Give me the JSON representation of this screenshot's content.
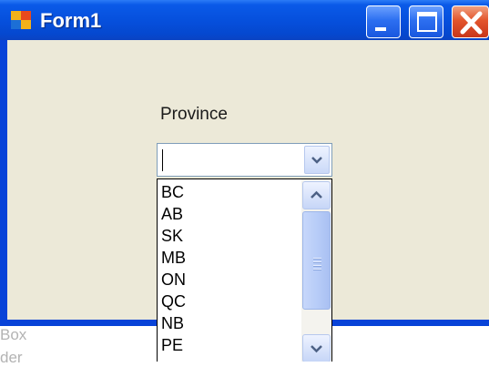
{
  "window": {
    "title": "Form1",
    "controls": {
      "minimize": "minimize",
      "maximize": "maximize",
      "close": "close"
    }
  },
  "form": {
    "province_label": "Province",
    "combo": {
      "value": "",
      "placeholder": ""
    },
    "dropdown_items": [
      "BC",
      "AB",
      "SK",
      "MB",
      "ON",
      "QC",
      "NB",
      "PE"
    ]
  },
  "background": {
    "line1": "Box",
    "line2": "der"
  },
  "colors": {
    "titlebar": "#0650dd",
    "client": "#ece9d8",
    "close_button": "#e3552c"
  }
}
